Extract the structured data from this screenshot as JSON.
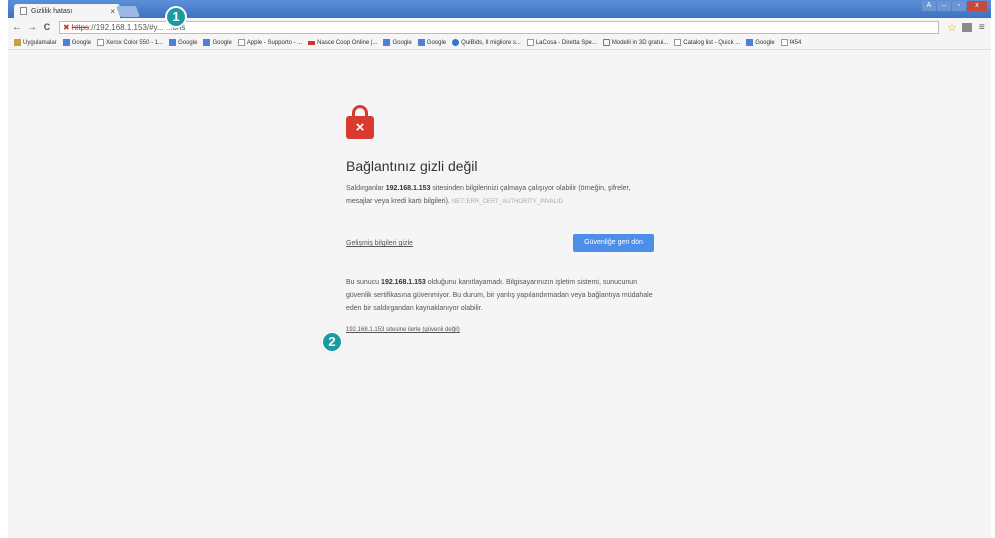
{
  "browser": {
    "tab_title": "Gizlilik hatası",
    "tab_close": "×",
    "address": {
      "scheme": "https",
      "rest": "://192.168.1.153/#y... ...ons"
    },
    "nav": {
      "back": "←",
      "forward": "→",
      "reload": "C"
    },
    "star": "☆",
    "menu": "≡",
    "window_controls": [
      "A",
      "–",
      "▫",
      "x"
    ]
  },
  "bookmarks": [
    {
      "icon": "grid-icon",
      "label": "Uygulamalar"
    },
    {
      "icon": "google-icon",
      "label": "Google"
    },
    {
      "icon": "page-icon",
      "label": "Xerox Color 550 - 1..."
    },
    {
      "icon": "google-icon",
      "label": "Google"
    },
    {
      "icon": "google-icon",
      "label": "Google"
    },
    {
      "icon": "page-icon",
      "label": "Apple - Supporto - ..."
    },
    {
      "icon": "nasce-icon",
      "label": "Nasce Coop Online |..."
    },
    {
      "icon": "google-icon",
      "label": "Google"
    },
    {
      "icon": "google-icon",
      "label": "Google"
    },
    {
      "icon": "quibids-icon",
      "label": "QuiBids, Il migliore s..."
    },
    {
      "icon": "page-icon",
      "label": "LaCosa - Diretta Spe..."
    },
    {
      "icon": "cart-icon",
      "label": "Modelli in 3D gratui..."
    },
    {
      "icon": "page-icon",
      "label": "Catalog list - Quick ..."
    },
    {
      "icon": "google-icon",
      "label": "Google"
    },
    {
      "icon": "page-icon",
      "label": "f454"
    }
  ],
  "error_page": {
    "headline": "Bağlantınız gizli değil",
    "desc_prefix": "Saldırganlar",
    "desc_host": "192.168.1.153",
    "desc_suffix": "sitesinden bilgilerinizi çalmaya çalışıyor olabilir (örneğin, şifreler, mesajlar veya kredi kartı bilgileri).",
    "error_code": "NET::ERR_CERT_AUTHORITY_INVALID",
    "advanced_link": "Gelişmiş bilgileri gizle",
    "back_button": "Güvenliğe geri dön",
    "details_prefix": "Bu sunucu",
    "details_host": "192.168.1.153",
    "details_suffix": "olduğunu kanıtlayamadı. Bilgisayarınızın işletim sistemi, sunucunun güvenlik sertifikasına güvenmiyor. Bu durum, bir yanlış yapılandırmadan veya bağlantıya müdahale eden bir saldırgandan kaynaklanıyor olabilir.",
    "proceed_link": "192.168.1.153 sitesine ilerle (güvenli değil)"
  },
  "callouts": [
    "1",
    "2"
  ],
  "colors": {
    "accent_button": "#4d8ee8",
    "lock_red": "#d93a2f",
    "callout_teal": "#1b9aa0"
  }
}
